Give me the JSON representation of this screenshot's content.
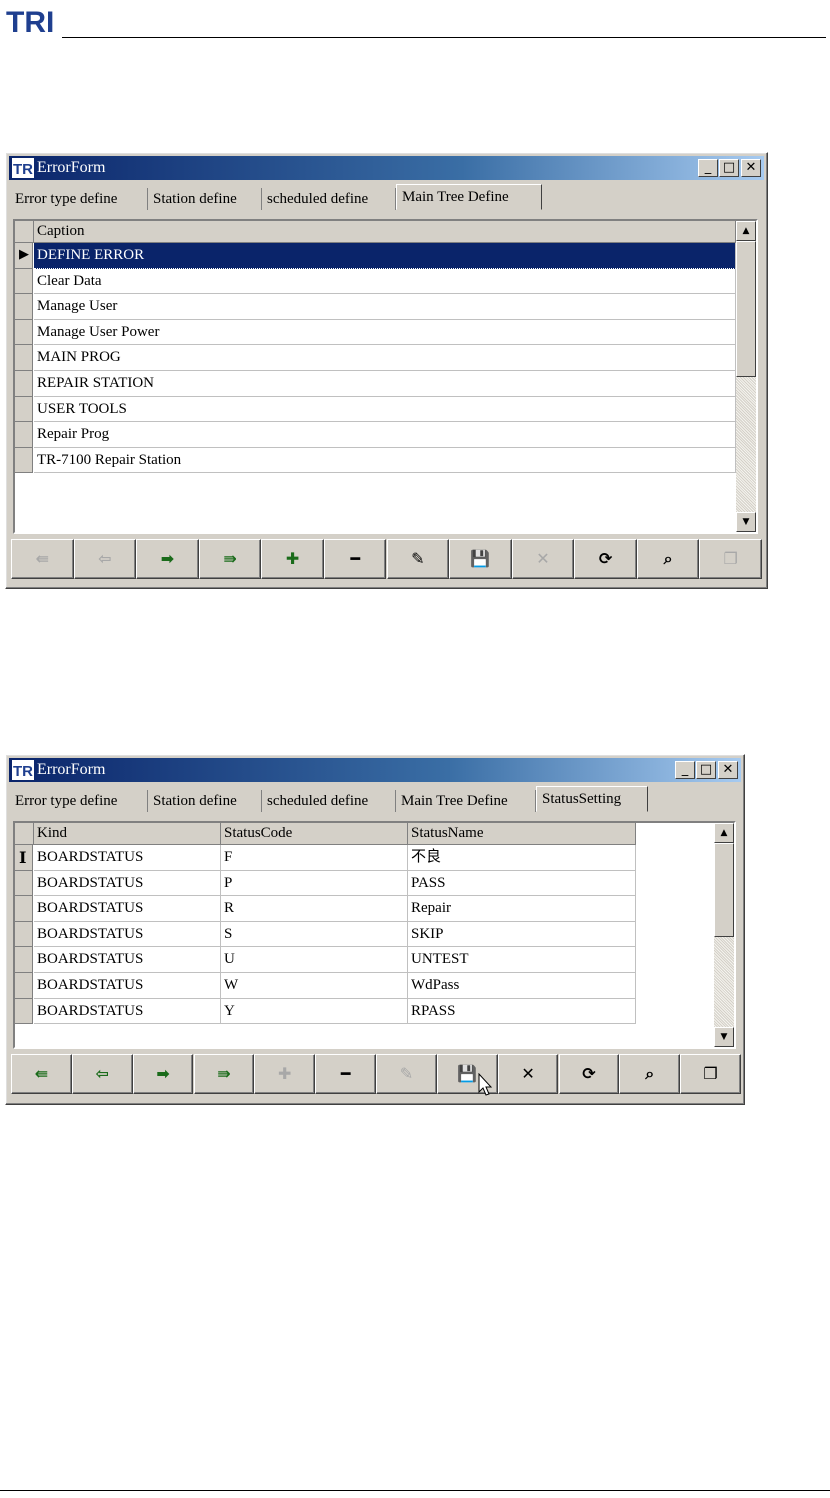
{
  "header": {
    "logo_text": "TRI"
  },
  "window1": {
    "title": "ErrorForm",
    "tabs": [
      "Error type define",
      "Station define",
      "scheduled define",
      "Main Tree Define"
    ],
    "active_tab": 3,
    "columns": [
      "Caption"
    ],
    "rows": [
      {
        "caption": "DEFINE ERROR",
        "selected": true
      },
      {
        "caption": "Clear Data"
      },
      {
        "caption": "Manage User"
      },
      {
        "caption": "Manage User Power"
      },
      {
        "caption": "MAIN PROG"
      },
      {
        "caption": "REPAIR STATION"
      },
      {
        "caption": "USER TOOLS"
      },
      {
        "caption": "Repair Prog"
      },
      {
        "caption": "TR-7100 Repair Station"
      }
    ],
    "navigator": [
      {
        "icon": "first-record-icon",
        "glyph": "⇚",
        "enabled": false
      },
      {
        "icon": "prior-record-icon",
        "glyph": "⇦",
        "enabled": false
      },
      {
        "icon": "next-record-icon",
        "glyph": "➡",
        "enabled": true
      },
      {
        "icon": "last-record-icon",
        "glyph": "⇛",
        "enabled": true
      },
      {
        "icon": "insert-record-icon",
        "glyph": "✚",
        "enabled": true
      },
      {
        "icon": "delete-record-icon",
        "glyph": "━",
        "enabled": true
      },
      {
        "icon": "edit-record-icon",
        "glyph": "✎",
        "enabled": true
      },
      {
        "icon": "post-record-icon",
        "glyph": "💾",
        "enabled": false
      },
      {
        "icon": "cancel-edit-icon",
        "glyph": "✕",
        "enabled": false
      },
      {
        "icon": "refresh-icon",
        "glyph": "⟳",
        "enabled": true
      },
      {
        "icon": "search-icon",
        "glyph": "⌕",
        "enabled": true
      },
      {
        "icon": "copy-records-icon",
        "glyph": "❐",
        "enabled": false
      }
    ]
  },
  "window2": {
    "title": "ErrorForm",
    "tabs": [
      "Error type define",
      "Station define",
      "scheduled define",
      "Main Tree Define",
      "StatusSetting"
    ],
    "active_tab": 4,
    "columns": [
      "Kind",
      "StatusCode",
      "StatusName"
    ],
    "rows": [
      {
        "kind": "BOARDSTATUS",
        "code": "F",
        "name": "不良",
        "editing": true
      },
      {
        "kind": "BOARDSTATUS",
        "code": "P",
        "name": "PASS"
      },
      {
        "kind": "BOARDSTATUS",
        "code": "R",
        "name": "Repair"
      },
      {
        "kind": "BOARDSTATUS",
        "code": "S",
        "name": "SKIP"
      },
      {
        "kind": "BOARDSTATUS",
        "code": "U",
        "name": "UNTEST"
      },
      {
        "kind": "BOARDSTATUS",
        "code": "W",
        "name": "WdPass"
      },
      {
        "kind": "BOARDSTATUS",
        "code": "Y",
        "name": "RPASS"
      }
    ],
    "navigator": [
      {
        "icon": "first-record-icon",
        "glyph": "⇚",
        "enabled": true
      },
      {
        "icon": "prior-record-icon",
        "glyph": "⇦",
        "enabled": true
      },
      {
        "icon": "next-record-icon",
        "glyph": "➡",
        "enabled": true
      },
      {
        "icon": "last-record-icon",
        "glyph": "⇛",
        "enabled": true
      },
      {
        "icon": "insert-record-icon",
        "glyph": "✚",
        "enabled": false
      },
      {
        "icon": "delete-record-icon",
        "glyph": "━",
        "enabled": true
      },
      {
        "icon": "edit-record-icon",
        "glyph": "✎",
        "enabled": false
      },
      {
        "icon": "post-record-icon",
        "glyph": "💾",
        "enabled": true
      },
      {
        "icon": "cancel-edit-icon",
        "glyph": "✕",
        "enabled": true
      },
      {
        "icon": "refresh-icon",
        "glyph": "⟳",
        "enabled": true
      },
      {
        "icon": "search-icon",
        "glyph": "⌕",
        "enabled": true
      },
      {
        "icon": "copy-records-icon",
        "glyph": "❐",
        "enabled": true
      }
    ]
  },
  "colors": {
    "titlebar": "#0a246a",
    "face": "#d4d0c8",
    "selection": "#0a246a",
    "enabled_arrow": "#1a6b1a"
  }
}
